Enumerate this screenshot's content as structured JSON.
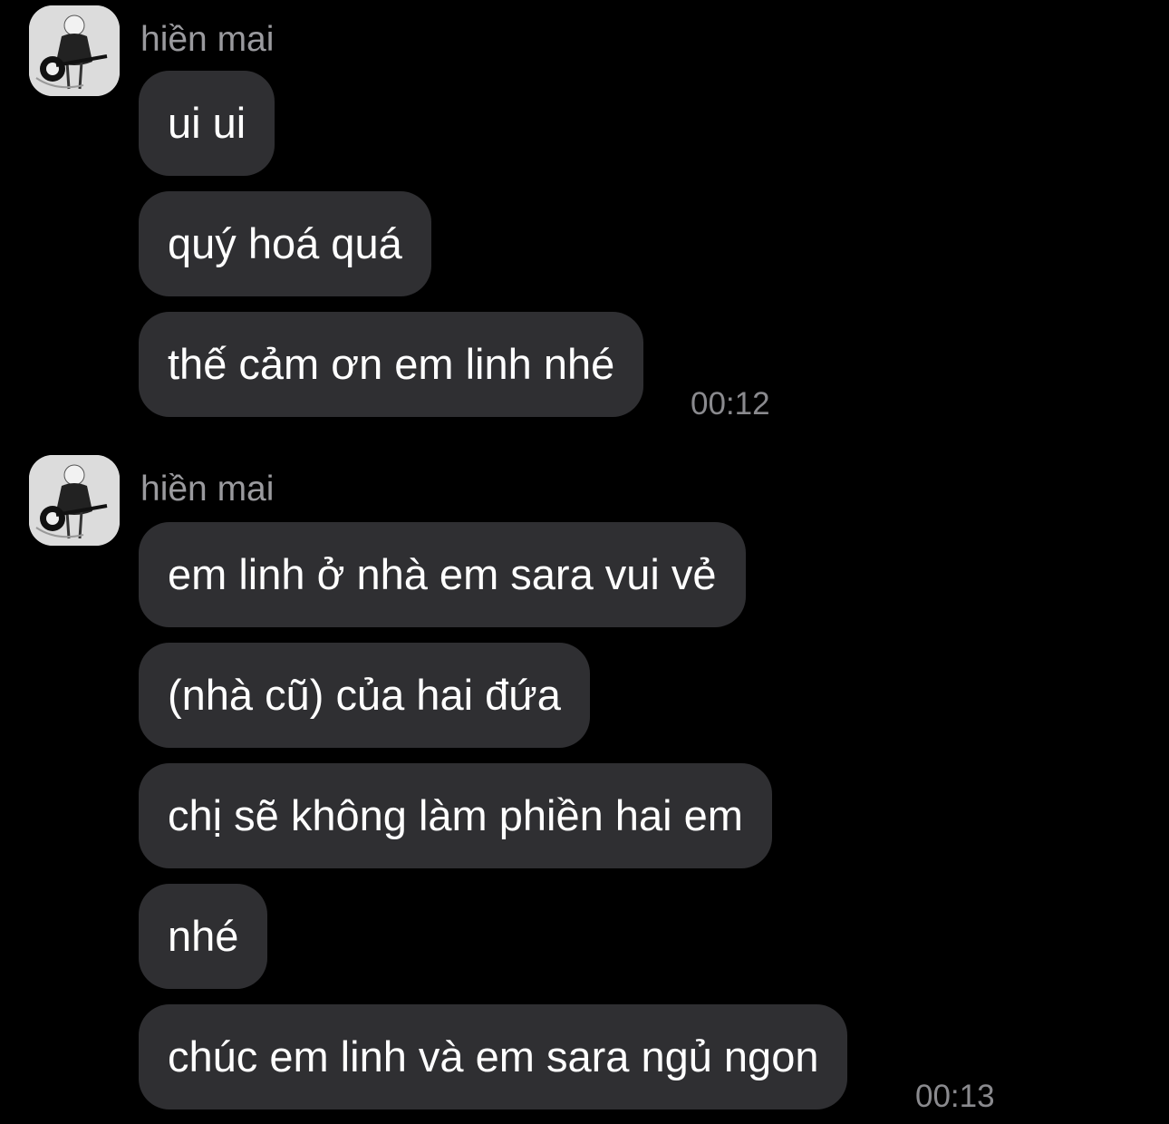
{
  "colors": {
    "background": "#000000",
    "bubble": "#2f2f32",
    "bubble_text": "#ffffff",
    "sender_name": "#9a9a9e",
    "timestamp": "#8a8a8e"
  },
  "groups": [
    {
      "sender": "hiền mai",
      "avatar_icon": "avatar-photo-icon",
      "messages": [
        "ui ui",
        "quý hoá quá",
        "thế cảm ơn em linh nhé"
      ],
      "time": "00:12"
    },
    {
      "sender": "hiền mai",
      "avatar_icon": "avatar-photo-icon",
      "messages": [
        "em linh ở nhà em sara vui vẻ",
        "(nhà cũ) của hai đứa",
        "chị sẽ không làm phiền hai em",
        "nhé",
        "chúc em linh và em sara ngủ ngon"
      ],
      "time": "00:13"
    }
  ]
}
